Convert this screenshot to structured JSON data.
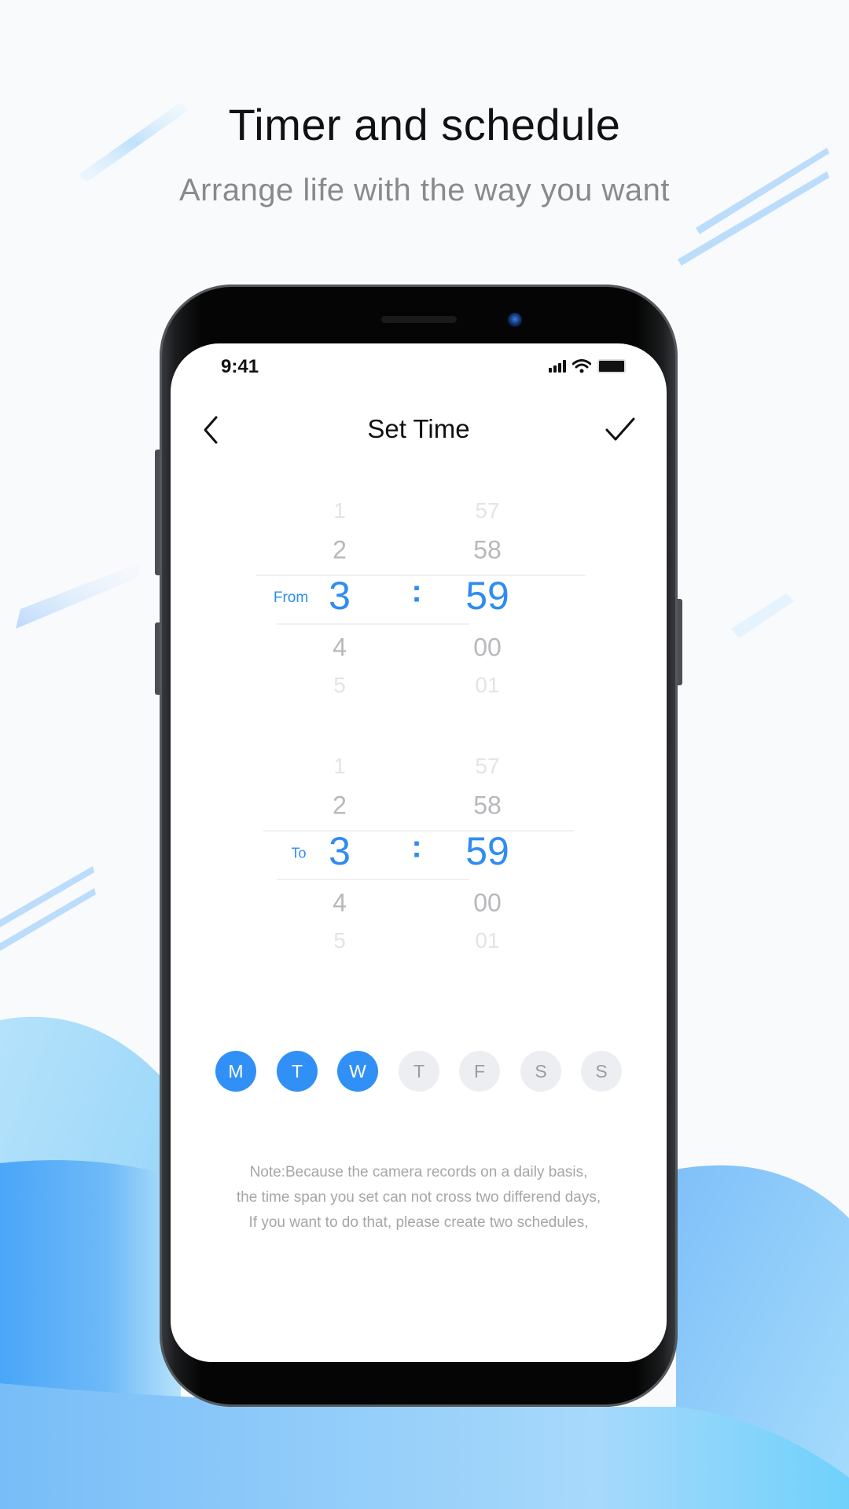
{
  "promo": {
    "title": "Timer and schedule",
    "subtitle": "Arrange life with the way you want"
  },
  "colors": {
    "accent": "#3190f5",
    "day_off_bg": "#eceef2",
    "wave_light": "#a9dcfa",
    "wave_deep": "#4aa8f7"
  },
  "status_bar": {
    "time": "9:41",
    "icons": [
      "signal-icon",
      "wifi-icon",
      "battery-icon"
    ]
  },
  "nav": {
    "back_icon": "chevron-left-icon",
    "title": "Set Time",
    "confirm_icon": "checkmark-icon"
  },
  "pickers": [
    {
      "label": "From",
      "hours": [
        "1",
        "2",
        "3",
        "4",
        "5"
      ],
      "minutes": [
        "57",
        "58",
        "59",
        "00",
        "01"
      ],
      "selected_hour": "3",
      "selected_minute": "59",
      "separator": ":"
    },
    {
      "label": "To",
      "hours": [
        "1",
        "2",
        "3",
        "4",
        "5"
      ],
      "minutes": [
        "57",
        "58",
        "59",
        "00",
        "01"
      ],
      "selected_hour": "3",
      "selected_minute": "59",
      "separator": ":"
    }
  ],
  "days": [
    {
      "label": "M",
      "selected": true
    },
    {
      "label": "T",
      "selected": true
    },
    {
      "label": "W",
      "selected": true
    },
    {
      "label": "T",
      "selected": false
    },
    {
      "label": "F",
      "selected": false
    },
    {
      "label": "S",
      "selected": false
    },
    {
      "label": "S",
      "selected": false
    }
  ],
  "note": {
    "lines": [
      "Note:Because the camera records on a daily basis,",
      "the time span you set can not cross two differend days,",
      "If you want to do that, please create two schedules,"
    ]
  }
}
